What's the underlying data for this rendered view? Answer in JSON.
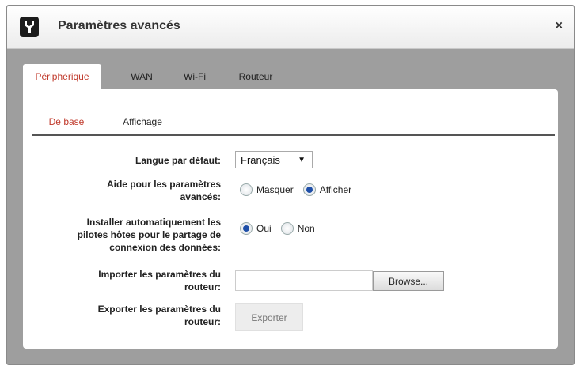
{
  "dialog": {
    "title": "Paramètres avancés",
    "close_label": "×"
  },
  "tabs": [
    {
      "label": "Périphérique",
      "active": true
    },
    {
      "label": "WAN",
      "active": false
    },
    {
      "label": "Wi-Fi",
      "active": false
    },
    {
      "label": "Routeur",
      "active": false
    }
  ],
  "subtabs": [
    {
      "label": "De base",
      "active": true
    },
    {
      "label": "Affichage",
      "active": false
    }
  ],
  "form": {
    "language": {
      "label": "Langue par défaut:",
      "value": "Français",
      "arrow": "▼"
    },
    "help": {
      "label_line1": "Aide pour les paramètres",
      "label_line2": "avancés:",
      "options": [
        "Masquer",
        "Afficher"
      ],
      "selected": "Afficher"
    },
    "drivers": {
      "label_line1": "Installer automatiquement les",
      "label_line2": "pilotes hôtes pour le partage de",
      "label_line3": "connexion des données:",
      "options": [
        "Oui",
        "Non"
      ],
      "selected": "Oui"
    },
    "import": {
      "label_line1": "Importer les paramètres du",
      "label_line2": "routeur:",
      "value": "",
      "button": "Browse..."
    },
    "export": {
      "label_line1": "Exporter les paramètres du",
      "label_line2": "routeur:",
      "button": "Exporter"
    }
  },
  "colors": {
    "accent": "#c0392b",
    "radio_checked": "#1f4fa8",
    "backdrop": "#9e9e9e"
  }
}
